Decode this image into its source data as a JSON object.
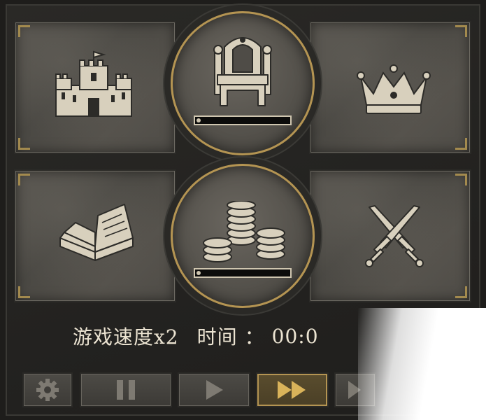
{
  "status_bar": {
    "speed_label": "游戏速度x2",
    "time_label": "时间",
    "time_separator": "：",
    "time_value": "00:0"
  },
  "meters": {
    "throne_progress": 0.04,
    "treasury_progress": 0.04
  },
  "icons": {
    "castle": "castle-icon",
    "throne": "throne-icon",
    "crown": "crown-icon",
    "book": "book-icon",
    "coins": "coins-icon",
    "swords": "crossed-swords-icon"
  },
  "controls": [
    "settings",
    "pause",
    "play",
    "fast-forward",
    "fastest"
  ],
  "colors": {
    "gold_accent": "#b49452",
    "icon_ivory": "#d8d0bd",
    "panel_stone": "#4f4c47",
    "text": "#ece4d2"
  }
}
